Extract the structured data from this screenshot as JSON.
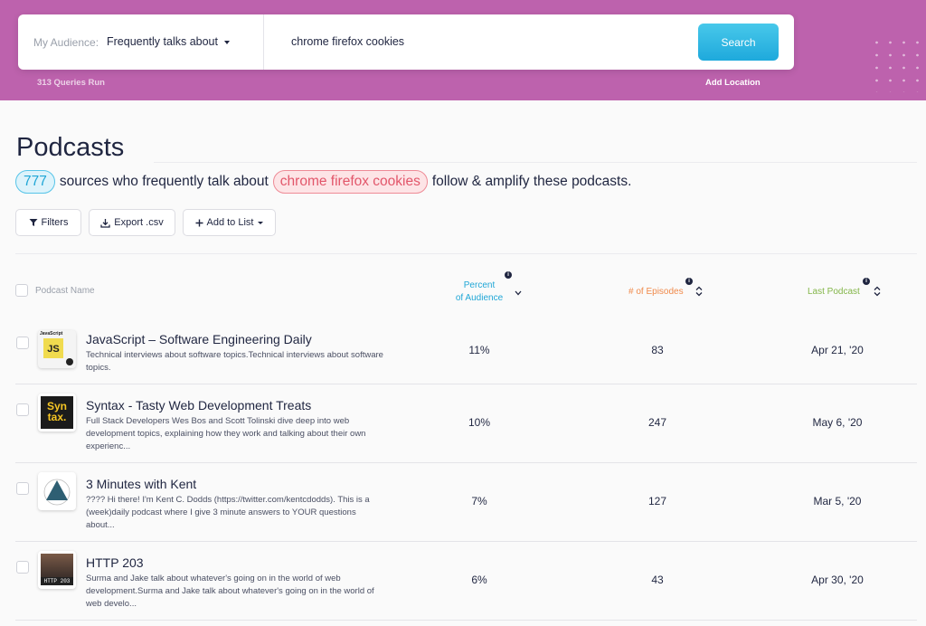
{
  "search": {
    "audience_label": "My Audience:",
    "audience_value": "Frequently talks about",
    "query": "chrome firefox cookies",
    "button": "Search",
    "queries_run": "313 Queries Run",
    "add_location": "Add Location"
  },
  "page": {
    "title": "Podcasts",
    "count": "777",
    "summary_before": "sources who frequently talk about",
    "topic": "chrome firefox cookies",
    "summary_after": "follow & amplify these podcasts."
  },
  "toolbar": {
    "filters": "Filters",
    "export": "Export .csv",
    "add_to_list": "Add to List"
  },
  "table": {
    "columns": {
      "name": "Podcast Name",
      "percent_line1": "Percent",
      "percent_line2": "of Audience",
      "episodes": "# of Episodes",
      "last": "Last Podcast"
    },
    "rows": [
      {
        "title": "JavaScript – Software Engineering Daily",
        "description": "Technical interviews about software topics.Technical interviews about software topics.",
        "percent": "11%",
        "episodes": "83",
        "last": "Apr 21, '20",
        "logo_text": "JS",
        "logo_caption": "JavaScript"
      },
      {
        "title": "Syntax - Tasty Web Development Treats",
        "description": "Full Stack Developers Wes Bos and Scott Tolinski dive deep into web development topics, explaining how they work and talking about their own experienc...",
        "percent": "10%",
        "episodes": "247",
        "last": "May 6, '20",
        "logo_text": "Syn tax."
      },
      {
        "title": "3 Minutes with Kent",
        "description": "???? Hi there! I'm Kent C. Dodds (https://twitter.com/kentcdodds). This is a (week)daily podcast where I give 3 minute answers to YOUR questions about...",
        "percent": "7%",
        "episodes": "127",
        "last": "Mar 5, '20"
      },
      {
        "title": "HTTP 203",
        "description": "Surma and Jake talk about whatever's going on in the world of web development.Surma and Jake talk about whatever's going on in the world of web develo...",
        "percent": "6%",
        "episodes": "43",
        "last": "Apr 30, '20",
        "logo_text": "HTTP 203"
      }
    ]
  },
  "colors": {
    "header": "#bd62ad",
    "accent_blue": "#1fa6d6",
    "accent_red": "#e2566a",
    "accent_orange": "#f08a4b",
    "accent_green": "#84b64a"
  }
}
